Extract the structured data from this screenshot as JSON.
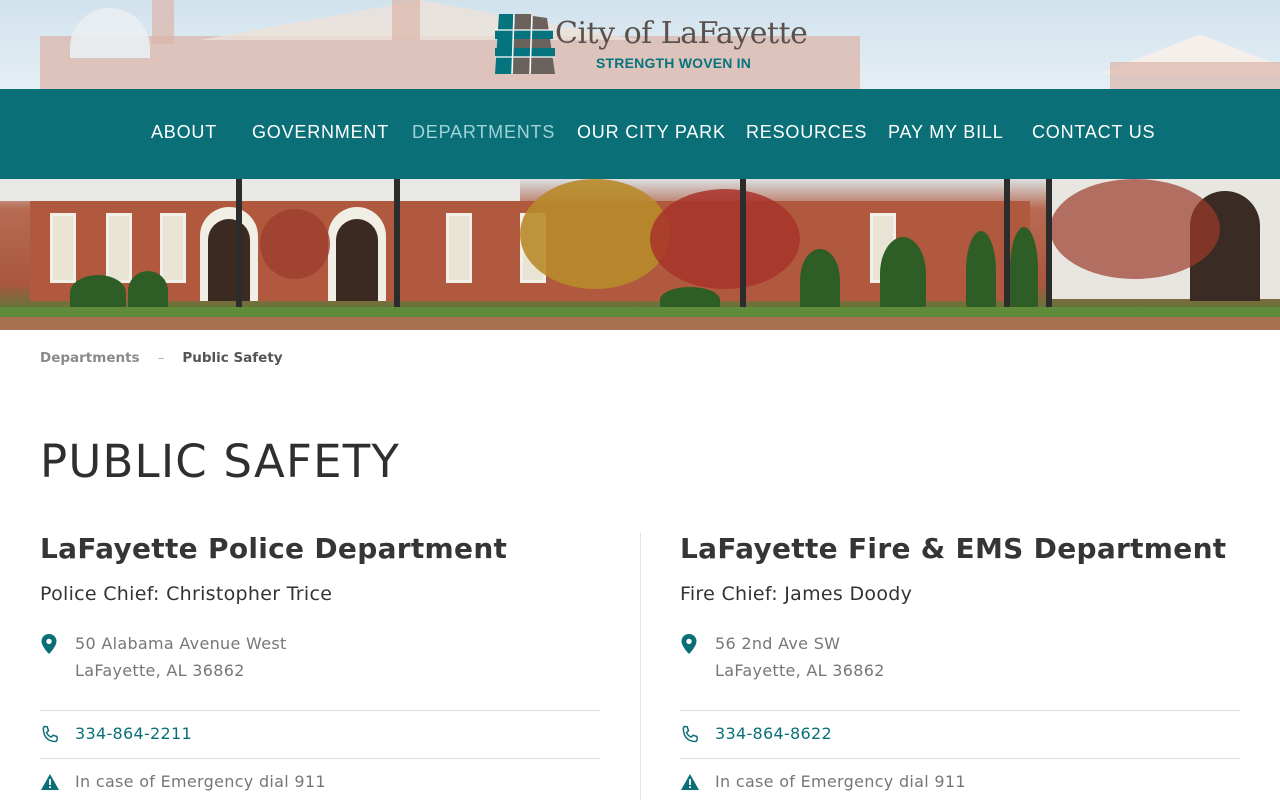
{
  "brand": {
    "name": "City of LaFayette",
    "tagline": "STRENGTH WOVEN IN",
    "colors": {
      "primary": "#0b6f78",
      "nav_active": "#9fd3d7",
      "text": "#333333",
      "muted": "#777777"
    }
  },
  "nav": {
    "items": [
      {
        "label": "ABOUT"
      },
      {
        "label": "GOVERNMENT"
      },
      {
        "label": "DEPARTMENTS",
        "active": true
      },
      {
        "label": "OUR CITY PARK"
      },
      {
        "label": "RESOURCES"
      },
      {
        "label": "PAY MY BILL"
      },
      {
        "label": "CONTACT US"
      }
    ]
  },
  "breadcrumb": {
    "parent": "Departments",
    "separator": "–",
    "current": "Public Safety"
  },
  "page": {
    "title": "PUBLIC SAFETY"
  },
  "departments": [
    {
      "name": "LaFayette Police Department",
      "chief": "Police Chief: Christopher Trice",
      "address_line1": "50 Alabama Avenue West",
      "address_line2": "LaFayette, AL 36862",
      "phone": "334-864-2211",
      "emergency": "In case of Emergency dial 911"
    },
    {
      "name": "LaFayette Fire & EMS Department",
      "chief": "Fire Chief: James Doody",
      "address_line1": "56 2nd Ave SW",
      "address_line2": "LaFayette, AL 36862",
      "phone": "334-864-8622",
      "emergency": "In case of Emergency dial 911"
    }
  ],
  "icons": {
    "location": "map-pin-icon",
    "phone": "phone-icon",
    "warning": "warning-icon"
  }
}
